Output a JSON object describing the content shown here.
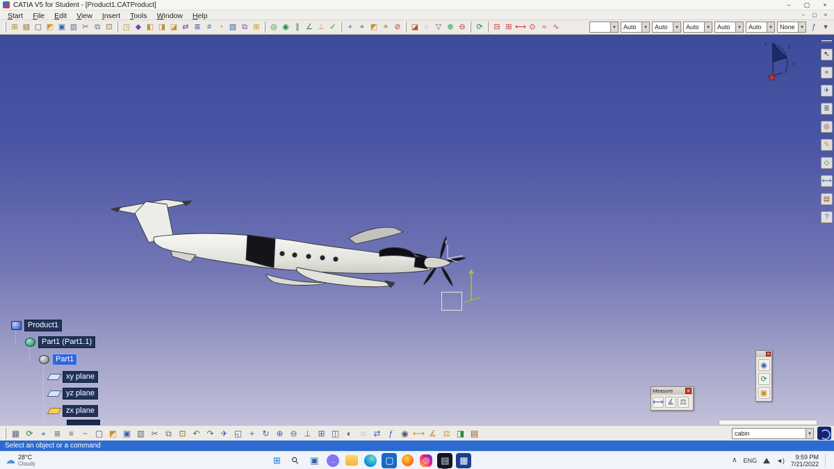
{
  "titlebar": {
    "title": "CATIA V5 for Student - [Product1.CATProduct]",
    "minimize": "–",
    "maximize": "▢",
    "close": "×"
  },
  "menubar": {
    "items": [
      "Start",
      "File",
      "Edit",
      "View",
      "Insert",
      "Tools",
      "Window",
      "Help"
    ],
    "doc_controls": {
      "minimize": "–",
      "restore": "▢",
      "close": "×"
    }
  },
  "toolbar_top": {
    "std": [
      {
        "name": "template-icon",
        "glyph": "⊞",
        "color": "#a8862a"
      },
      {
        "name": "browser-icon",
        "glyph": "▤",
        "color": "#8a6a2a"
      },
      {
        "name": "new-icon",
        "glyph": "▢",
        "color": "#556"
      },
      {
        "name": "open-icon",
        "glyph": "◩",
        "color": "#c89b2e"
      },
      {
        "name": "save-icon",
        "glyph": "▣",
        "color": "#3b62b0"
      },
      {
        "name": "print-icon",
        "glyph": "▥",
        "color": "#667"
      },
      {
        "name": "cut-icon",
        "glyph": "✂",
        "color": "#667"
      },
      {
        "name": "copy-icon",
        "glyph": "⧉",
        "color": "#667"
      },
      {
        "name": "paste-icon",
        "glyph": "⊡",
        "color": "#8a6a2a"
      }
    ],
    "product_structure": [
      {
        "name": "new-component-icon",
        "glyph": "◳",
        "color": "#c8902c"
      },
      {
        "name": "new-product-icon",
        "glyph": "◆",
        "color": "#7a3cc0"
      },
      {
        "name": "new-part-icon",
        "glyph": "◧",
        "color": "#c8902c"
      },
      {
        "name": "existing-component-icon",
        "glyph": "◨",
        "color": "#c8902c"
      },
      {
        "name": "existing-component-positioned-icon",
        "glyph": "◪",
        "color": "#c8902c"
      },
      {
        "name": "replace-component-icon",
        "glyph": "⇄",
        "color": "#7a3cc0"
      },
      {
        "name": "graph-tree-reordering-icon",
        "glyph": "≣",
        "color": "#3b62b0"
      },
      {
        "name": "generate-numbering-icon",
        "glyph": "#",
        "color": "#3b62b0"
      },
      {
        "name": "selective-load-icon",
        "glyph": "◔",
        "color": "#c8902c"
      },
      {
        "name": "manage-representations-icon",
        "glyph": "▧",
        "color": "#3b62b0"
      },
      {
        "name": "multi-instantiation-icon",
        "glyph": "⧉",
        "color": "#7a3cc0"
      },
      {
        "name": "fast-multi-instantiation-icon",
        "glyph": "⊞",
        "color": "#c8902c"
      }
    ],
    "constraints": [
      {
        "name": "coincidence-constraint-icon",
        "glyph": "◎",
        "color": "#2a8a3a"
      },
      {
        "name": "contact-constraint-icon",
        "glyph": "◉",
        "color": "#2a8a3a"
      },
      {
        "name": "offset-constraint-icon",
        "glyph": "∥",
        "color": "#2a8a3a"
      },
      {
        "name": "angle-constraint-icon",
        "glyph": "∠",
        "color": "#2a8a3a"
      },
      {
        "name": "fix-component-icon",
        "glyph": "⊥",
        "color": "#c8902c"
      },
      {
        "name": "quick-constraint-icon",
        "glyph": "✓",
        "color": "#2a8a3a"
      }
    ],
    "move": [
      {
        "name": "manipulation-icon",
        "glyph": "+",
        "color": "#3b62b0"
      },
      {
        "name": "snap-icon",
        "glyph": "⌖",
        "color": "#3b62b0"
      },
      {
        "name": "smart-move-icon",
        "glyph": "◩",
        "color": "#c8902c"
      },
      {
        "name": "explode-icon",
        "glyph": "✶",
        "color": "#c8902c"
      },
      {
        "name": "stop-manipulate-icon",
        "glyph": "⊘",
        "color": "#b04040"
      }
    ],
    "features": [
      {
        "name": "split-icon",
        "glyph": "◪",
        "color": "#b05030"
      },
      {
        "name": "hole-icon",
        "glyph": "◌",
        "color": "#667"
      },
      {
        "name": "pocket-icon",
        "glyph": "▽",
        "color": "#667"
      },
      {
        "name": "add-icon",
        "glyph": "⊕",
        "color": "#2a8a3a"
      },
      {
        "name": "remove-icon",
        "glyph": "⊖",
        "color": "#b04040"
      }
    ],
    "update": [
      {
        "name": "update-icon",
        "glyph": "⟳",
        "color": "#2a8a3a"
      }
    ],
    "weld": [
      {
        "name": "clash-icon",
        "glyph": "⊟",
        "color": "#d03434"
      },
      {
        "name": "sectioning-icon",
        "glyph": "⊞",
        "color": "#d03434"
      },
      {
        "name": "distance-band-analysis-icon",
        "glyph": "⟷",
        "color": "#d03434"
      },
      {
        "name": "spot-weld-icon",
        "glyph": "⊙",
        "color": "#d03434"
      },
      {
        "name": "seam-weld-icon",
        "glyph": "≈",
        "color": "#d03434"
      },
      {
        "name": "arc-weld-icon",
        "glyph": "∿",
        "color": "#d03434"
      }
    ],
    "combos": [
      {
        "name": "graphic-weight-combo",
        "value": "",
        "swatch": true
      },
      {
        "name": "line-type-combo",
        "value": "Auto"
      },
      {
        "name": "point-type-combo",
        "value": "Auto"
      },
      {
        "name": "thickness-combo",
        "value": "Auto"
      },
      {
        "name": "color-combo",
        "value": "Auto"
      },
      {
        "name": "layer-combo",
        "value": "Auto"
      },
      {
        "name": "filter-combo",
        "value": "None"
      }
    ],
    "end_icons": [
      {
        "name": "knowledge-icon",
        "glyph": "ƒ",
        "color": "#3b62b0"
      },
      {
        "name": "more-tools-icon",
        "glyph": "▾",
        "color": "#556"
      }
    ]
  },
  "viewport": {
    "compass": {
      "x": "x",
      "y": "y",
      "z": "z"
    },
    "nose_axis": {
      "z": "z"
    }
  },
  "tree": {
    "items": [
      {
        "label": "Product1",
        "icon": "product",
        "indent": 8,
        "name": "tree-node-product1"
      },
      {
        "label": "Part1 (Part1.1)",
        "icon": "part",
        "indent": 28,
        "name": "tree-node-part1-instance"
      },
      {
        "label": "Part1",
        "icon": "partbody",
        "indent": 48,
        "selected": true,
        "name": "tree-node-part1"
      },
      {
        "label": "xy plane",
        "icon": "plane",
        "indent": 62,
        "name": "tree-node-xy-plane"
      },
      {
        "label": "yz plane",
        "icon": "plane",
        "indent": 62,
        "name": "tree-node-yz-plane"
      },
      {
        "label": "zx plane",
        "icon": "plane-hl",
        "indent": 62,
        "name": "tree-node-zx-plane"
      }
    ]
  },
  "measure": {
    "title": "Measure",
    "close": "×",
    "icons": [
      {
        "name": "measure-between-icon",
        "glyph": "⟷",
        "color": "#3b62b0"
      },
      {
        "name": "measure-item-icon",
        "glyph": "∡",
        "color": "#3b62b0"
      },
      {
        "name": "measure-inertia-icon",
        "glyph": "⚖",
        "color": "#556"
      }
    ]
  },
  "palette": {
    "close": "×",
    "icons": [
      {
        "name": "enhanced-scene-icon",
        "glyph": "◉",
        "color": "#3b62b0"
      },
      {
        "name": "update-icon",
        "glyph": "⟳",
        "color": "#2a8a3a"
      },
      {
        "name": "snapshot-icon",
        "glyph": "▣",
        "color": "#c8902c"
      }
    ]
  },
  "right_toolbar": {
    "icons": [
      {
        "name": "select-icon",
        "glyph": "↖",
        "color": "#222"
      },
      {
        "name": "center-graph-icon",
        "glyph": "⌖",
        "color": "#556"
      },
      {
        "name": "fly-icon",
        "glyph": "✈",
        "color": "#3b62b0"
      },
      {
        "name": "specification-tree-icon",
        "glyph": "≣",
        "color": "#556"
      },
      {
        "name": "compass-icon",
        "glyph": "◎",
        "color": "#b03434"
      },
      {
        "name": "sketcher-icon",
        "glyph": "✎",
        "color": "#c8902c"
      },
      {
        "name": "plane-icon",
        "glyph": "◇",
        "color": "#2a8a3a"
      },
      {
        "name": "measure-icon",
        "glyph": "⟷",
        "color": "#3b62b0"
      },
      {
        "name": "catalog-icon",
        "glyph": "▤",
        "color": "#8a5a20"
      },
      {
        "name": "help-icon",
        "glyph": "?",
        "color": "#3b62b0"
      }
    ]
  },
  "bottom": {
    "icons": [
      {
        "name": "p2-ui-icon",
        "glyph": "▦",
        "color": "#667"
      },
      {
        "name": "update-icon",
        "glyph": "⟳",
        "color": "#2a8a3a"
      },
      {
        "name": "axis-system-icon",
        "glyph": "⌖",
        "color": "#3b62b0"
      },
      {
        "name": "graph-icon",
        "glyph": "≣",
        "color": "#667"
      },
      {
        "name": "tree-expand-icon",
        "glyph": "≡",
        "color": "#667"
      },
      {
        "name": "interrupt-icon",
        "glyph": "−",
        "color": "#d03434"
      },
      {
        "name": "new-icon",
        "glyph": "▢",
        "color": "#556"
      },
      {
        "name": "open-icon",
        "glyph": "◩",
        "color": "#c8902c"
      },
      {
        "name": "save-icon",
        "glyph": "▣",
        "color": "#3b62b0"
      },
      {
        "name": "quick-print-icon",
        "glyph": "▥",
        "color": "#667"
      },
      {
        "name": "cut-icon",
        "glyph": "✂",
        "color": "#667"
      },
      {
        "name": "copy-icon",
        "glyph": "⧉",
        "color": "#667"
      },
      {
        "name": "paste-icon",
        "glyph": "⊡",
        "color": "#8a6a2a"
      },
      {
        "name": "undo-icon",
        "glyph": "↶",
        "color": "#2a8a3a"
      },
      {
        "name": "redo-icon",
        "glyph": "↷",
        "color": "#2a8a3a"
      },
      {
        "name": "fly-mode-icon",
        "glyph": "✈",
        "color": "#3b62b0"
      },
      {
        "name": "fit-all-in-icon",
        "glyph": "◱",
        "color": "#3b62b0"
      },
      {
        "name": "pan-icon",
        "glyph": "+",
        "color": "#3b62b0"
      },
      {
        "name": "rotate-icon",
        "glyph": "↻",
        "color": "#3b62b0"
      },
      {
        "name": "zoom-in-icon",
        "glyph": "⊕",
        "color": "#3b62b0"
      },
      {
        "name": "zoom-out-icon",
        "glyph": "⊖",
        "color": "#3b62b0"
      },
      {
        "name": "normal-view-icon",
        "glyph": "⊥",
        "color": "#3b62b0"
      },
      {
        "name": "multi-view-icon",
        "glyph": "⊞",
        "color": "#3b62b0"
      },
      {
        "name": "quick-view-icon",
        "glyph": "◫",
        "color": "#3b62b0"
      },
      {
        "name": "render-style-icon",
        "glyph": "◐",
        "color": "#556"
      },
      {
        "name": "hide-show-icon",
        "glyph": "◌",
        "color": "#3b62b0"
      },
      {
        "name": "swap-visible-space-icon",
        "glyph": "⇄",
        "color": "#3b62b0"
      },
      {
        "name": "formula-icon",
        "glyph": "ƒ",
        "color": "#3b62b0"
      },
      {
        "name": "image-capture-icon",
        "glyph": "◉",
        "color": "#556"
      },
      {
        "name": "measure-between-icon",
        "glyph": "⟷",
        "color": "#c8902c"
      },
      {
        "name": "measure-item-icon",
        "glyph": "∡",
        "color": "#c8902c"
      },
      {
        "name": "measure-inertia-icon",
        "glyph": "⚖",
        "color": "#c8902c"
      },
      {
        "name": "apply-material-icon",
        "glyph": "◨",
        "color": "#2a8a3a"
      },
      {
        "name": "catalog-browser-icon",
        "glyph": "▤",
        "color": "#8a5a20"
      }
    ],
    "power_value": "cabin"
  },
  "statusbar": {
    "message": "Select an object or a command"
  },
  "taskbar": {
    "weather": {
      "temp": "28°C",
      "condition": "Cloudy",
      "glyph": "☁"
    },
    "center_icons": [
      {
        "name": "start-button",
        "glyph": "⊞",
        "fg": "#0b78d4",
        "cls": ""
      },
      {
        "name": "search-button",
        "glyph": "⚲",
        "fg": "#333",
        "cls": "rot"
      },
      {
        "name": "task-view-button",
        "glyph": "▣",
        "fg": "#2b5fa8",
        "cls": ""
      },
      {
        "name": "chat-icon",
        "glyph": "‥",
        "fg": "#fff",
        "bg": "#8375f0",
        "cls": "bubble"
      },
      {
        "name": "file-explorer-icon",
        "glyph": "",
        "cls": "folder"
      },
      {
        "name": "edge-icon",
        "glyph": "",
        "cls": "edge"
      },
      {
        "name": "store-icon",
        "glyph": "▢",
        "fg": "#fff",
        "bg": "#1769c8",
        "cls": ""
      },
      {
        "name": "firefox-icon",
        "glyph": "",
        "cls": "fire"
      },
      {
        "name": "instagram-icon",
        "glyph": "◎",
        "fg": "#fff",
        "cls": "insta"
      },
      {
        "name": "catia-taskbar-icon",
        "glyph": "▤",
        "fg": "#cfd4ff",
        "bg": "#14141e",
        "active": true,
        "cls": ""
      },
      {
        "name": "blue-app-icon",
        "glyph": "▦",
        "fg": "#fff",
        "bg": "#1b3f8f",
        "cls": ""
      }
    ],
    "tray": {
      "chevron": "∧",
      "lang": "ENG",
      "volume": "◄)",
      "time": "9:59 PM",
      "date": "7/21/2022"
    }
  }
}
